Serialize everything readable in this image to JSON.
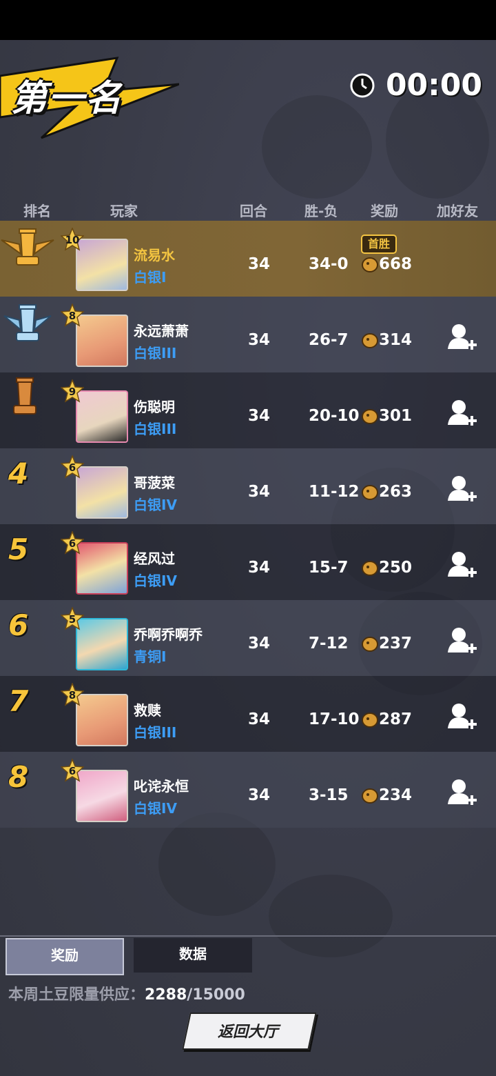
{
  "banner": {
    "title": "第一名"
  },
  "timer": {
    "value": "00:00"
  },
  "headers": {
    "rank": "排名",
    "player": "玩家",
    "rounds": "回合",
    "wl": "胜-负",
    "reward": "奖励",
    "add_friend": "加好友"
  },
  "players": [
    {
      "rank": "1",
      "level": "10",
      "name": "流易水",
      "tier": "白银I",
      "rounds": "34",
      "wl": "34-0",
      "reward": "668",
      "badge": "首胜"
    },
    {
      "rank": "2",
      "level": "8",
      "name": "永远萧萧",
      "tier": "白银III",
      "rounds": "34",
      "wl": "26-7",
      "reward": "314"
    },
    {
      "rank": "3",
      "level": "9",
      "name": "伤聪明",
      "tier": "白银III",
      "rounds": "34",
      "wl": "20-10",
      "reward": "301"
    },
    {
      "rank": "4",
      "level": "6",
      "name": "哥菠菜",
      "tier": "白银IV",
      "rounds": "34",
      "wl": "11-12",
      "reward": "263"
    },
    {
      "rank": "5",
      "level": "6",
      "name": "经风过",
      "tier": "白银IV",
      "rounds": "34",
      "wl": "15-7",
      "reward": "250"
    },
    {
      "rank": "6",
      "level": "5",
      "name": "乔啊乔啊乔",
      "tier": "青铜I",
      "rounds": "34",
      "wl": "7-12",
      "reward": "237"
    },
    {
      "rank": "7",
      "level": "8",
      "name": "救赎",
      "tier": "白银III",
      "rounds": "34",
      "wl": "17-10",
      "reward": "287"
    },
    {
      "rank": "8",
      "level": "6",
      "name": "叱诧永恒",
      "tier": "白银IV",
      "rounds": "34",
      "wl": "3-15",
      "reward": "234"
    }
  ],
  "tabs": {
    "reward": "奖励",
    "data": "数据"
  },
  "supply": {
    "label": "本周土豆限量供应：",
    "current": "2288",
    "max": "/15000"
  },
  "back_button": "返回大厅",
  "colors": {
    "gold_row": "#7a6233",
    "tier_blue": "#3d9df5",
    "rank_yellow": "#f7c43a"
  }
}
